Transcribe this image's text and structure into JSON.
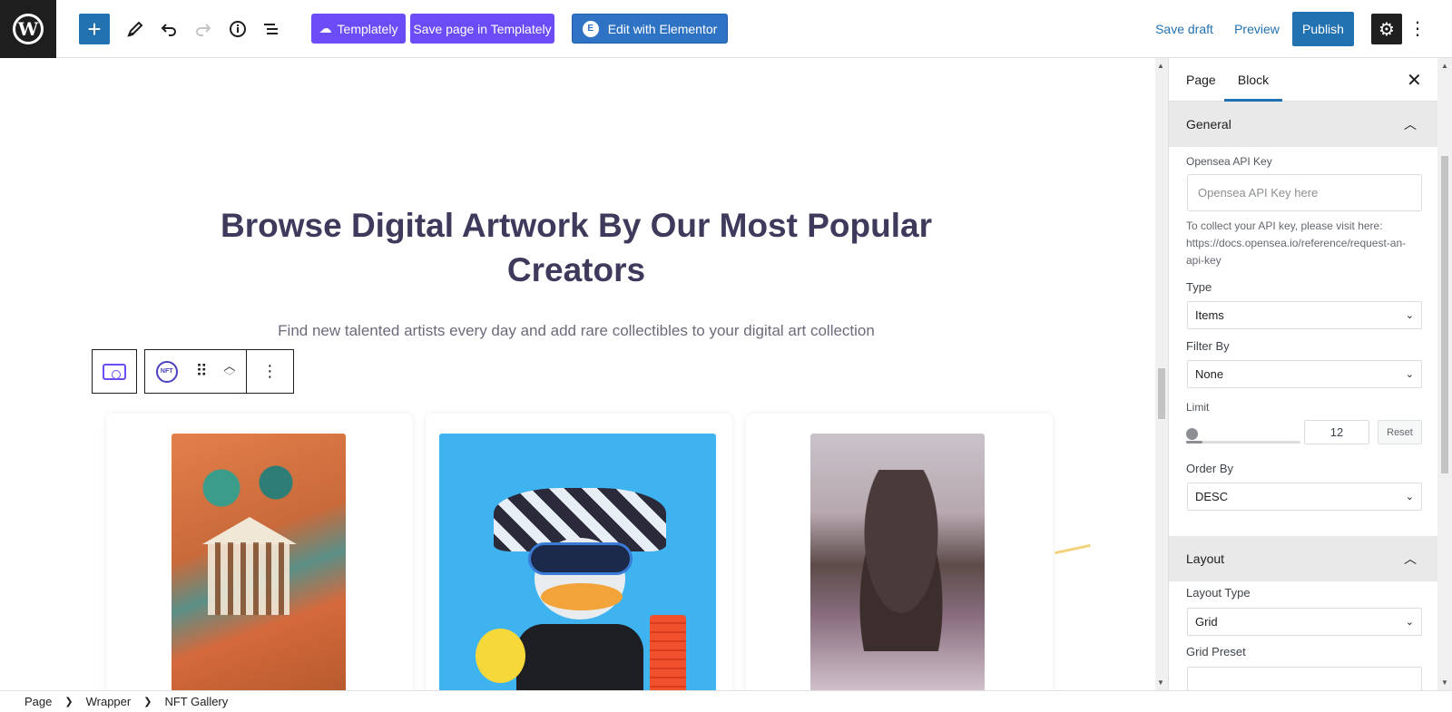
{
  "toolbar": {
    "logo_letter": "W",
    "add_icon": "+",
    "templately_label": "Templately",
    "save_templately_label": "Save page in Templately",
    "elementor_label": "Edit with Elementor",
    "elementor_badge": "E",
    "save_draft_label": "Save draft",
    "preview_label": "Preview",
    "publish_label": "Publish",
    "icons": [
      "wordpress-logo-icon",
      "plus-icon",
      "pencil-icon",
      "undo-icon",
      "redo-icon",
      "info-icon",
      "list-view-icon",
      "templately-icon",
      "elementor-icon",
      "gear-icon",
      "more-vertical-icon"
    ]
  },
  "canvas": {
    "heading": "Browse Digital Artwork By Our Most Popular Creators",
    "subtext": "Find new talented artists every day and add rare collectibles to your digital art collection",
    "block_label": "NFT",
    "artworks": [
      "nft-artwork-1",
      "nft-artwork-2",
      "nft-artwork-3"
    ]
  },
  "sidebar": {
    "tabs": [
      "Page",
      "Block"
    ],
    "active_tab": "Block",
    "general_title": "General",
    "api_key_label": "Opensea API Key",
    "api_key_placeholder": "Opensea API Key here",
    "api_help": "To collect your API key, please visit here: https://docs.opensea.io/reference/request-an-api-key",
    "type_label": "Type",
    "type_value": "Items",
    "filter_label": "Filter By",
    "filter_value": "None",
    "limit_label": "Limit",
    "limit_value": "12",
    "reset_label": "Reset",
    "order_label": "Order By",
    "order_value": "DESC",
    "layout_title": "Layout",
    "layout_type_label": "Layout Type",
    "layout_type_value": "Grid",
    "grid_preset_label": "Grid Preset"
  },
  "breadcrumb": [
    "Page",
    "Wrapper",
    "NFT Gallery"
  ],
  "colors": {
    "accent": "#2271b1",
    "templately": "#6b4cf6",
    "elementor": "#2f73c4",
    "heading": "#3d3a5c"
  }
}
